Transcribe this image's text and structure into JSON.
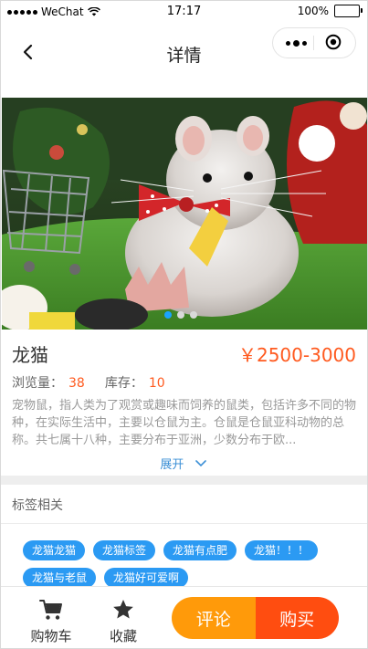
{
  "status_bar": {
    "carrier": "WeChat",
    "time": "17:17",
    "battery": "100%"
  },
  "nav": {
    "title": "详情",
    "back_icon": "chevron-left-icon",
    "more_icon": "more-dots-icon",
    "close_icon": "target-icon"
  },
  "hero": {
    "image": "chinchilla eating on artificial grass with shopping cart toy",
    "slides": 3,
    "active_slide": 0
  },
  "product": {
    "name": "龙猫",
    "price": "￥2500-3000",
    "views_label": "浏览量：",
    "views": "38",
    "stock_label": "库存：",
    "stock": "10",
    "description": "宠物鼠，指人类为了观赏或趣味而饲养的鼠类，包括许多不同的物种，在实际生活中，主要以仓鼠为主。仓鼠是仓鼠亚科动物的总称。共七属十八种，主要分布于亚洲，少数分布于欧...",
    "expand_label": "展开"
  },
  "tags_section": {
    "title": "标签相关",
    "tags": [
      "龙猫龙猫",
      "龙猫标签",
      "龙猫有点肥",
      "龙猫！！！",
      "龙猫与老鼠",
      "龙猫好可爱啊"
    ]
  },
  "bottom_bar": {
    "cart_label": "购物车",
    "favorite_label": "收藏",
    "comment_label": "评论",
    "buy_label": "购买"
  },
  "colors": {
    "accent_price": "#ff5a1f",
    "tag_blue": "#2b9af3",
    "comment_orange": "#ff9a0a",
    "buy_red": "#ff4d10",
    "indicator_active": "#1aa3ff"
  }
}
